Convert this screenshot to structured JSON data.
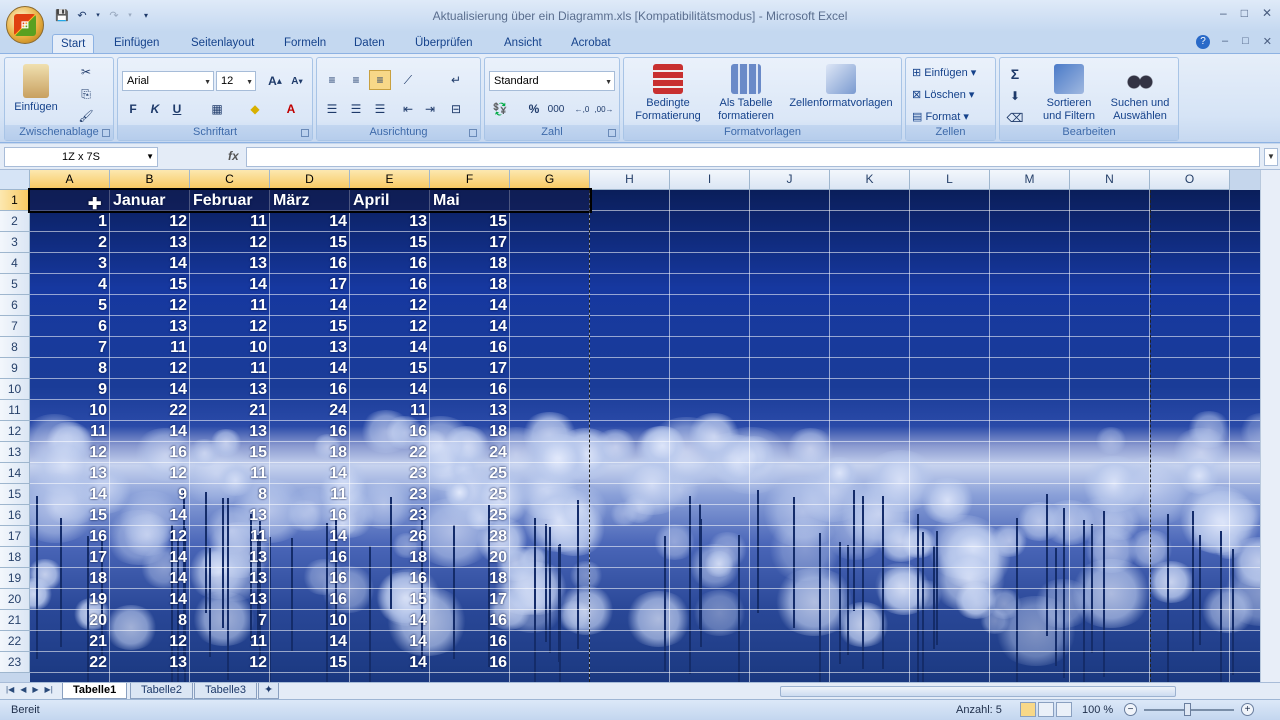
{
  "window": {
    "title": "Aktualisierung über ein Diagramm.xls  [Kompatibilitätsmodus] - Microsoft Excel",
    "min": "–",
    "max": "□",
    "close": "✕"
  },
  "ribbon_tabs": [
    "Start",
    "Einfügen",
    "Seitenlayout",
    "Formeln",
    "Daten",
    "Überprüfen",
    "Ansicht",
    "Acrobat"
  ],
  "clipboard": {
    "paste": "Einfügen",
    "group": "Zwischenablage"
  },
  "font": {
    "name": "Arial",
    "size": "12",
    "bold": "F",
    "italic": "K",
    "underline": "U",
    "group": "Schriftart"
  },
  "alignment": {
    "group": "Ausrichtung"
  },
  "number": {
    "format": "Standard",
    "percent": "%",
    "thousands": "000",
    "group": "Zahl"
  },
  "styles": {
    "conditional": [
      "Bedingte",
      "Formatierung"
    ],
    "table": [
      "Als Tabelle",
      "formatieren"
    ],
    "cell": "Zellenformatvorlagen",
    "group": "Formatvorlagen"
  },
  "cells": {
    "insert": "Einfügen",
    "delete": "Löschen",
    "format": "Format",
    "group": "Zellen"
  },
  "editing": {
    "sum": "Σ",
    "sort": [
      "Sortieren",
      "und Filtern"
    ],
    "find": [
      "Suchen und",
      "Auswählen"
    ],
    "group": "Bearbeiten"
  },
  "formula_bar": {
    "name_box": "1Z x 7S",
    "fx": "fx",
    "value": ""
  },
  "columns": [
    "A",
    "B",
    "C",
    "D",
    "E",
    "F",
    "G",
    "H",
    "I",
    "J",
    "K",
    "L",
    "M",
    "N",
    "O"
  ],
  "rows": [
    "1",
    "2",
    "3",
    "4",
    "5",
    "6",
    "7",
    "8",
    "9",
    "10",
    "11",
    "12",
    "13",
    "14",
    "15",
    "16",
    "17",
    "18",
    "19",
    "20",
    "21",
    "22",
    "23"
  ],
  "header_row": [
    "",
    "Januar",
    "Februar",
    "März",
    "April",
    "Mai",
    ""
  ],
  "data": [
    [
      1,
      12,
      11,
      14,
      13,
      15
    ],
    [
      2,
      13,
      12,
      15,
      15,
      17
    ],
    [
      3,
      14,
      13,
      16,
      16,
      18
    ],
    [
      4,
      15,
      14,
      17,
      16,
      18
    ],
    [
      5,
      12,
      11,
      14,
      12,
      14
    ],
    [
      6,
      13,
      12,
      15,
      12,
      14
    ],
    [
      7,
      11,
      10,
      13,
      14,
      16
    ],
    [
      8,
      12,
      11,
      14,
      15,
      17
    ],
    [
      9,
      14,
      13,
      16,
      14,
      16
    ],
    [
      10,
      22,
      21,
      24,
      11,
      13
    ],
    [
      11,
      14,
      13,
      16,
      16,
      18
    ],
    [
      12,
      16,
      15,
      18,
      22,
      24
    ],
    [
      13,
      12,
      11,
      14,
      23,
      25
    ],
    [
      14,
      9,
      8,
      11,
      23,
      25
    ],
    [
      15,
      14,
      13,
      16,
      23,
      25
    ],
    [
      16,
      12,
      11,
      14,
      26,
      28
    ],
    [
      17,
      14,
      13,
      16,
      18,
      20
    ],
    [
      18,
      14,
      13,
      16,
      16,
      18
    ],
    [
      19,
      14,
      13,
      16,
      15,
      17
    ],
    [
      20,
      8,
      7,
      10,
      14,
      16
    ],
    [
      21,
      12,
      11,
      14,
      14,
      16
    ],
    [
      22,
      13,
      12,
      15,
      14,
      16
    ]
  ],
  "sheets": [
    "Tabelle1",
    "Tabelle2",
    "Tabelle3"
  ],
  "active_sheet": "Tabelle1",
  "status": {
    "ready": "Bereit",
    "count": "Anzahl: 5",
    "zoom": "100 %"
  }
}
